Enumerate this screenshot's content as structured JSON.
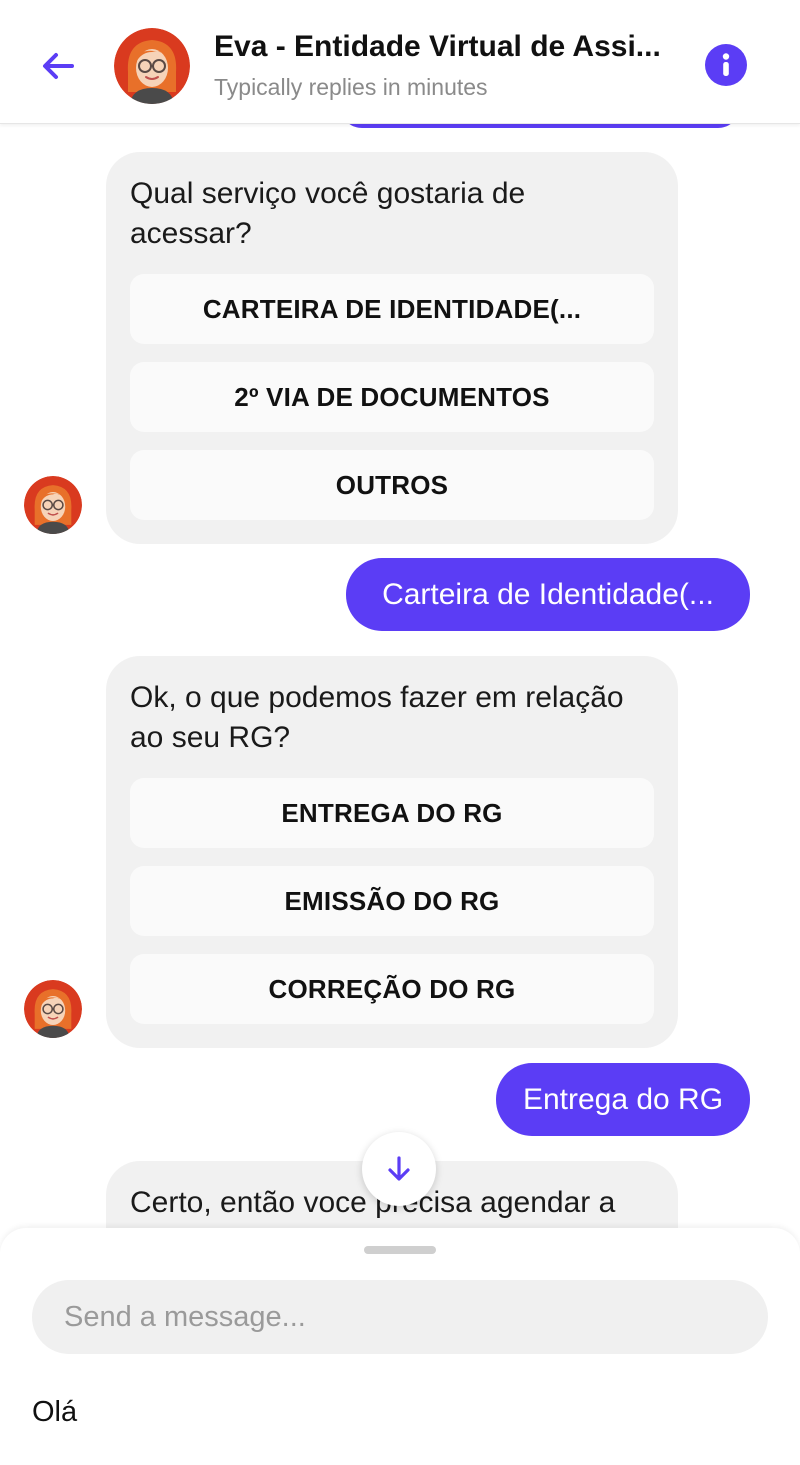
{
  "header": {
    "title": "Eva - Entidade Virtual de Assi...",
    "subtitle": "Typically replies in minutes",
    "back_icon": "arrow-left-icon",
    "info_icon": "info-icon"
  },
  "colors": {
    "accent": "#5b3df5",
    "bot_bubble": "#f1f1f1",
    "option_button": "#fafafa"
  },
  "messages": [
    {
      "from": "bot",
      "text": "Qual serviço você gostaria de acessar?",
      "options": [
        "CARTEIRA DE IDENTIDADE(...",
        "2º VIA DE DOCUMENTOS",
        "OUTROS"
      ]
    },
    {
      "from": "user",
      "text": "Carteira de Identidade(..."
    },
    {
      "from": "bot",
      "text": "Ok, o que podemos fazer em relação ao seu RG?",
      "options": [
        "ENTREGA DO RG",
        "EMISSÃO DO RG",
        "CORREÇÃO DO RG"
      ]
    },
    {
      "from": "user",
      "text": "Entrega do RG"
    },
    {
      "from": "bot",
      "text": "Certo, então voce precisa agendar a"
    }
  ],
  "composer": {
    "placeholder": "Send a message...",
    "quick_reply": "Olá"
  }
}
